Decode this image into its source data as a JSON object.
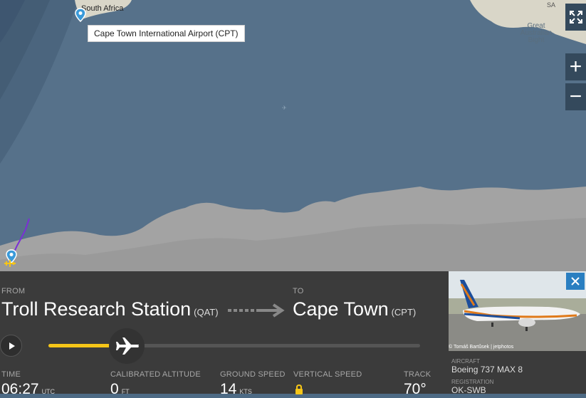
{
  "map": {
    "tooltip": "Cape Town International Airport (CPT)",
    "labels": {
      "south_africa": "South Africa",
      "sa": "SA",
      "bight": "Great\nAustralian\nBight"
    }
  },
  "controls": {
    "fullscreen_icon": "fullscreen-icon",
    "zoom_in": "+",
    "zoom_out": "−"
  },
  "flight": {
    "from_label": "FROM",
    "to_label": "TO",
    "from_city": "Troll Research Station",
    "from_code": "(QAT)",
    "to_city": "Cape Town",
    "to_code": "(CPT)",
    "progress": 0.2,
    "stats": [
      {
        "label": "TIME",
        "value": "06:27",
        "unit": "UTC"
      },
      {
        "label": "CALIBRATED ALTITUDE",
        "value": "0",
        "unit": "FT"
      },
      {
        "label": "GROUND SPEED",
        "value": "14",
        "unit": "KTS"
      },
      {
        "label": "VERTICAL SPEED",
        "value": "",
        "unit": ""
      },
      {
        "label": "TRACK",
        "value": "70°",
        "unit": ""
      }
    ]
  },
  "aircraft": {
    "photo_credit": "© Tomáš Bartůsek | jetphotos",
    "aircraft_label": "AIRCRAFT",
    "aircraft_value": "Boeing 737 MAX 8",
    "registration_label": "REGISTRATION",
    "registration_value": "OK-SWB"
  },
  "colors": {
    "ocean": "#56718a",
    "land": "#9b9b9b",
    "panel": "#3b3b3b",
    "accent": "#f5c518",
    "track": "#7b2fd6",
    "close": "#2a7fc1"
  }
}
